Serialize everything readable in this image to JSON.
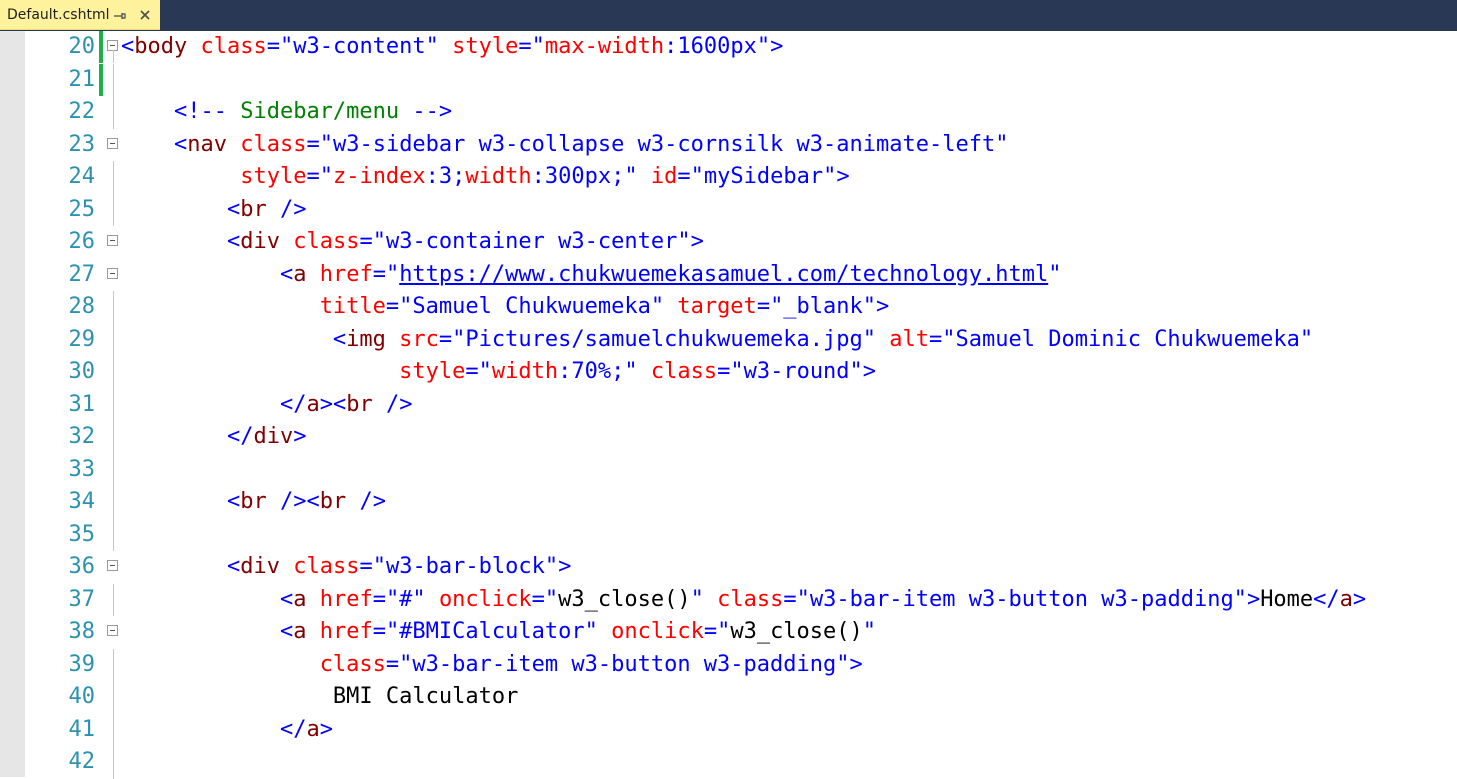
{
  "tab": {
    "title": "Default.cshtml",
    "pin_icon": "pin-icon",
    "close_icon": "close-icon"
  },
  "colors": {
    "tab_background": "#fff29d",
    "tabstrip_background": "#293955",
    "line_number": "#2b91af",
    "tag": "#800000",
    "attribute": "#ff0000",
    "value": "#0000ff",
    "comment": "#008000",
    "change_marker": "#1fb04a"
  },
  "lines": [
    {
      "num": "20",
      "fold": true,
      "changed": true,
      "tokens": [
        {
          "t": "dlm",
          "v": "<"
        },
        {
          "t": "tag",
          "v": "body"
        },
        {
          "t": "txt",
          "v": " "
        },
        {
          "t": "attr",
          "v": "class"
        },
        {
          "t": "dlm",
          "v": "="
        },
        {
          "t": "val",
          "v": "\"w3-content\""
        },
        {
          "t": "txt",
          "v": " "
        },
        {
          "t": "attr",
          "v": "style"
        },
        {
          "t": "dlm",
          "v": "="
        },
        {
          "t": "val",
          "v": "\""
        },
        {
          "t": "attr",
          "v": "max-width"
        },
        {
          "t": "dlm",
          "v": ":"
        },
        {
          "t": "val",
          "v": "1600px\""
        },
        {
          "t": "dlm",
          "v": ">"
        }
      ]
    },
    {
      "num": "21",
      "fold": false,
      "changed": true,
      "tokens": []
    },
    {
      "num": "22",
      "fold": false,
      "changed": false,
      "tokens": [
        {
          "t": "txt",
          "v": "    "
        },
        {
          "t": "dlm",
          "v": "<!--"
        },
        {
          "t": "cmt",
          "v": " Sidebar/menu "
        },
        {
          "t": "dlm",
          "v": "-->"
        }
      ]
    },
    {
      "num": "23",
      "fold": true,
      "changed": false,
      "tokens": [
        {
          "t": "txt",
          "v": "    "
        },
        {
          "t": "dlm",
          "v": "<"
        },
        {
          "t": "tag",
          "v": "nav"
        },
        {
          "t": "txt",
          "v": " "
        },
        {
          "t": "attr",
          "v": "class"
        },
        {
          "t": "dlm",
          "v": "="
        },
        {
          "t": "val",
          "v": "\"w3-sidebar w3-collapse w3-cornsilk w3-animate-left\""
        }
      ]
    },
    {
      "num": "24",
      "fold": false,
      "changed": false,
      "tokens": [
        {
          "t": "txt",
          "v": "         "
        },
        {
          "t": "attr",
          "v": "style"
        },
        {
          "t": "dlm",
          "v": "="
        },
        {
          "t": "val",
          "v": "\""
        },
        {
          "t": "attr",
          "v": "z-index"
        },
        {
          "t": "dlm",
          "v": ":"
        },
        {
          "t": "val",
          "v": "3;"
        },
        {
          "t": "attr",
          "v": "width"
        },
        {
          "t": "dlm",
          "v": ":"
        },
        {
          "t": "val",
          "v": "300px;\""
        },
        {
          "t": "txt",
          "v": " "
        },
        {
          "t": "attr",
          "v": "id"
        },
        {
          "t": "dlm",
          "v": "="
        },
        {
          "t": "val",
          "v": "\"mySidebar\""
        },
        {
          "t": "dlm",
          "v": ">"
        }
      ]
    },
    {
      "num": "25",
      "fold": false,
      "changed": false,
      "tokens": [
        {
          "t": "txt",
          "v": "        "
        },
        {
          "t": "dlm",
          "v": "<"
        },
        {
          "t": "tag",
          "v": "br"
        },
        {
          "t": "txt",
          "v": " "
        },
        {
          "t": "dlm",
          "v": "/>"
        }
      ]
    },
    {
      "num": "26",
      "fold": true,
      "changed": false,
      "tokens": [
        {
          "t": "txt",
          "v": "        "
        },
        {
          "t": "dlm",
          "v": "<"
        },
        {
          "t": "tag",
          "v": "div"
        },
        {
          "t": "txt",
          "v": " "
        },
        {
          "t": "attr",
          "v": "class"
        },
        {
          "t": "dlm",
          "v": "="
        },
        {
          "t": "val",
          "v": "\"w3-container w3-center\""
        },
        {
          "t": "dlm",
          "v": ">"
        }
      ]
    },
    {
      "num": "27",
      "fold": true,
      "changed": false,
      "tokens": [
        {
          "t": "txt",
          "v": "            "
        },
        {
          "t": "dlm",
          "v": "<"
        },
        {
          "t": "tag",
          "v": "a"
        },
        {
          "t": "txt",
          "v": " "
        },
        {
          "t": "attr",
          "v": "href"
        },
        {
          "t": "dlm",
          "v": "="
        },
        {
          "t": "val",
          "v": "\""
        },
        {
          "t": "link",
          "v": "https://www.chukwuemekasamuel.com/technology.html"
        },
        {
          "t": "val",
          "v": "\""
        }
      ]
    },
    {
      "num": "28",
      "fold": false,
      "changed": false,
      "tokens": [
        {
          "t": "txt",
          "v": "               "
        },
        {
          "t": "attr",
          "v": "title"
        },
        {
          "t": "dlm",
          "v": "="
        },
        {
          "t": "val",
          "v": "\"Samuel Chukwuemeka\""
        },
        {
          "t": "txt",
          "v": " "
        },
        {
          "t": "attr",
          "v": "target"
        },
        {
          "t": "dlm",
          "v": "="
        },
        {
          "t": "val",
          "v": "\"_blank\""
        },
        {
          "t": "dlm",
          "v": ">"
        }
      ]
    },
    {
      "num": "29",
      "fold": false,
      "changed": false,
      "tokens": [
        {
          "t": "txt",
          "v": "                "
        },
        {
          "t": "dlm",
          "v": "<"
        },
        {
          "t": "tag",
          "v": "img"
        },
        {
          "t": "txt",
          "v": " "
        },
        {
          "t": "attr",
          "v": "src"
        },
        {
          "t": "dlm",
          "v": "="
        },
        {
          "t": "val",
          "v": "\"Pictures/samuelchukwuemeka.jpg\""
        },
        {
          "t": "txt",
          "v": " "
        },
        {
          "t": "attr",
          "v": "alt"
        },
        {
          "t": "dlm",
          "v": "="
        },
        {
          "t": "val",
          "v": "\"Samuel Dominic Chukwuemeka\""
        }
      ]
    },
    {
      "num": "30",
      "fold": false,
      "changed": false,
      "tokens": [
        {
          "t": "txt",
          "v": "                     "
        },
        {
          "t": "attr",
          "v": "style"
        },
        {
          "t": "dlm",
          "v": "="
        },
        {
          "t": "val",
          "v": "\""
        },
        {
          "t": "attr",
          "v": "width"
        },
        {
          "t": "dlm",
          "v": ":"
        },
        {
          "t": "val",
          "v": "70%;\""
        },
        {
          "t": "txt",
          "v": " "
        },
        {
          "t": "attr",
          "v": "class"
        },
        {
          "t": "dlm",
          "v": "="
        },
        {
          "t": "val",
          "v": "\"w3-round\""
        },
        {
          "t": "dlm",
          "v": ">"
        }
      ]
    },
    {
      "num": "31",
      "fold": false,
      "changed": false,
      "tokens": [
        {
          "t": "txt",
          "v": "            "
        },
        {
          "t": "dlm",
          "v": "</"
        },
        {
          "t": "tag",
          "v": "a"
        },
        {
          "t": "dlm",
          "v": "><"
        },
        {
          "t": "tag",
          "v": "br"
        },
        {
          "t": "txt",
          "v": " "
        },
        {
          "t": "dlm",
          "v": "/>"
        }
      ]
    },
    {
      "num": "32",
      "fold": false,
      "changed": false,
      "tokens": [
        {
          "t": "txt",
          "v": "        "
        },
        {
          "t": "dlm",
          "v": "</"
        },
        {
          "t": "tag",
          "v": "div"
        },
        {
          "t": "dlm",
          "v": ">"
        }
      ]
    },
    {
      "num": "33",
      "fold": false,
      "changed": false,
      "tokens": []
    },
    {
      "num": "34",
      "fold": false,
      "changed": false,
      "tokens": [
        {
          "t": "txt",
          "v": "        "
        },
        {
          "t": "dlm",
          "v": "<"
        },
        {
          "t": "tag",
          "v": "br"
        },
        {
          "t": "txt",
          "v": " "
        },
        {
          "t": "dlm",
          "v": "/><"
        },
        {
          "t": "tag",
          "v": "br"
        },
        {
          "t": "txt",
          "v": " "
        },
        {
          "t": "dlm",
          "v": "/>"
        }
      ]
    },
    {
      "num": "35",
      "fold": false,
      "changed": false,
      "tokens": []
    },
    {
      "num": "36",
      "fold": true,
      "changed": false,
      "tokens": [
        {
          "t": "txt",
          "v": "        "
        },
        {
          "t": "dlm",
          "v": "<"
        },
        {
          "t": "tag",
          "v": "div"
        },
        {
          "t": "txt",
          "v": " "
        },
        {
          "t": "attr",
          "v": "class"
        },
        {
          "t": "dlm",
          "v": "="
        },
        {
          "t": "val",
          "v": "\"w3-bar-block\""
        },
        {
          "t": "dlm",
          "v": ">"
        }
      ]
    },
    {
      "num": "37",
      "fold": false,
      "changed": false,
      "tokens": [
        {
          "t": "txt",
          "v": "            "
        },
        {
          "t": "dlm",
          "v": "<"
        },
        {
          "t": "tag",
          "v": "a"
        },
        {
          "t": "txt",
          "v": " "
        },
        {
          "t": "attr",
          "v": "href"
        },
        {
          "t": "dlm",
          "v": "="
        },
        {
          "t": "val",
          "v": "\"#\""
        },
        {
          "t": "txt",
          "v": " "
        },
        {
          "t": "attr",
          "v": "onclick"
        },
        {
          "t": "dlm",
          "v": "="
        },
        {
          "t": "val",
          "v": "\""
        },
        {
          "t": "txt",
          "v": "w3_close()"
        },
        {
          "t": "val",
          "v": "\""
        },
        {
          "t": "txt",
          "v": " "
        },
        {
          "t": "attr",
          "v": "class"
        },
        {
          "t": "dlm",
          "v": "="
        },
        {
          "t": "val",
          "v": "\"w3-bar-item w3-button w3-padding\""
        },
        {
          "t": "dlm",
          "v": ">"
        },
        {
          "t": "txt",
          "v": "Home"
        },
        {
          "t": "dlm",
          "v": "</"
        },
        {
          "t": "tag",
          "v": "a"
        },
        {
          "t": "dlm",
          "v": ">"
        }
      ]
    },
    {
      "num": "38",
      "fold": true,
      "changed": false,
      "tokens": [
        {
          "t": "txt",
          "v": "            "
        },
        {
          "t": "dlm",
          "v": "<"
        },
        {
          "t": "tag",
          "v": "a"
        },
        {
          "t": "txt",
          "v": " "
        },
        {
          "t": "attr",
          "v": "href"
        },
        {
          "t": "dlm",
          "v": "="
        },
        {
          "t": "val",
          "v": "\"#BMICalculator\""
        },
        {
          "t": "txt",
          "v": " "
        },
        {
          "t": "attr",
          "v": "onclick"
        },
        {
          "t": "dlm",
          "v": "="
        },
        {
          "t": "val",
          "v": "\""
        },
        {
          "t": "txt",
          "v": "w3_close()"
        },
        {
          "t": "val",
          "v": "\""
        }
      ]
    },
    {
      "num": "39",
      "fold": false,
      "changed": false,
      "tokens": [
        {
          "t": "txt",
          "v": "               "
        },
        {
          "t": "attr",
          "v": "class"
        },
        {
          "t": "dlm",
          "v": "="
        },
        {
          "t": "val",
          "v": "\"w3-bar-item w3-button w3-padding\""
        },
        {
          "t": "dlm",
          "v": ">"
        }
      ]
    },
    {
      "num": "40",
      "fold": false,
      "changed": false,
      "tokens": [
        {
          "t": "txt",
          "v": "                BMI Calculator"
        }
      ]
    },
    {
      "num": "41",
      "fold": false,
      "changed": false,
      "tokens": [
        {
          "t": "txt",
          "v": "            "
        },
        {
          "t": "dlm",
          "v": "</"
        },
        {
          "t": "tag",
          "v": "a"
        },
        {
          "t": "dlm",
          "v": ">"
        }
      ]
    },
    {
      "num": "42",
      "fold": false,
      "changed": false,
      "tokens": []
    }
  ]
}
